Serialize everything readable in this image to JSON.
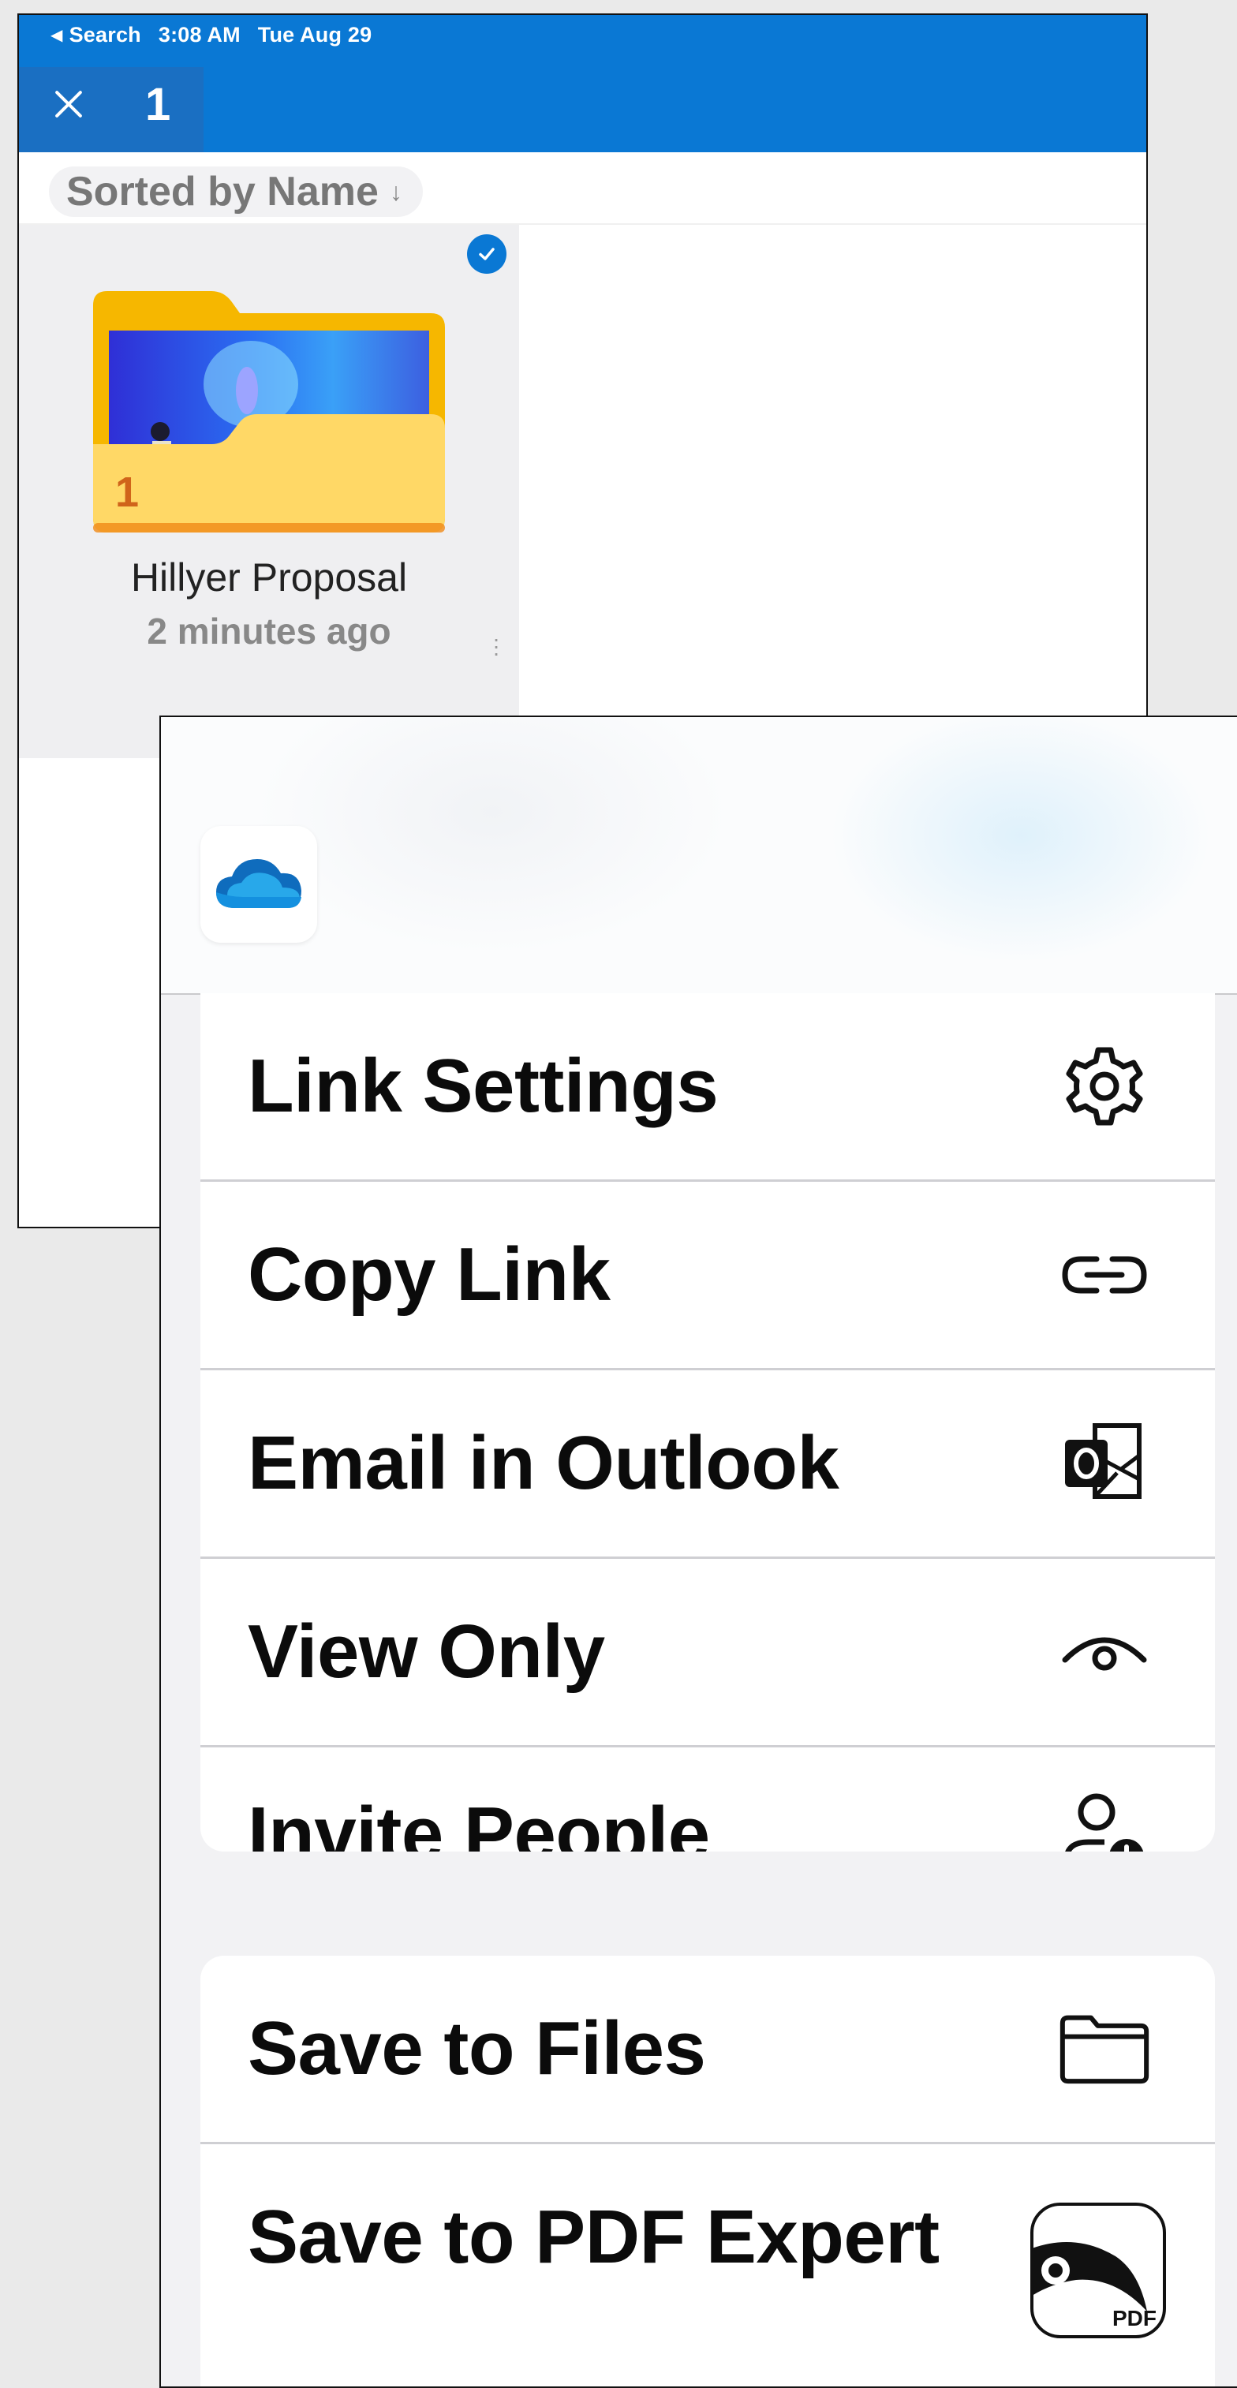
{
  "status_bar": {
    "back_label": "Search",
    "time": "3:08 AM",
    "date": "Tue Aug 29"
  },
  "selection": {
    "count": "1"
  },
  "sort": {
    "label": "Sorted by Name"
  },
  "folder_tile": {
    "name": "Hillyer Proposal",
    "modified": "2 minutes ago",
    "badge_count": "1"
  },
  "share_sheet": {
    "app": "OneDrive",
    "group1": [
      {
        "label": "Link Settings",
        "icon": "gear-icon"
      },
      {
        "label": "Copy Link",
        "icon": "link-icon"
      },
      {
        "label": "Email in Outlook",
        "icon": "outlook-icon"
      },
      {
        "label": "View Only",
        "icon": "eye-icon"
      },
      {
        "label": "Invite People",
        "icon": "add-person-icon"
      }
    ],
    "group2": [
      {
        "label": "Save to Files",
        "icon": "folder-icon"
      },
      {
        "label": "Save to PDF Expert",
        "icon": "pdf-expert-icon"
      }
    ],
    "pdf_icon_text": "PDF"
  },
  "colors": {
    "accent": "#0a78d4",
    "folder": "#f7c534",
    "sheet_bg": "#f2f2f4"
  }
}
